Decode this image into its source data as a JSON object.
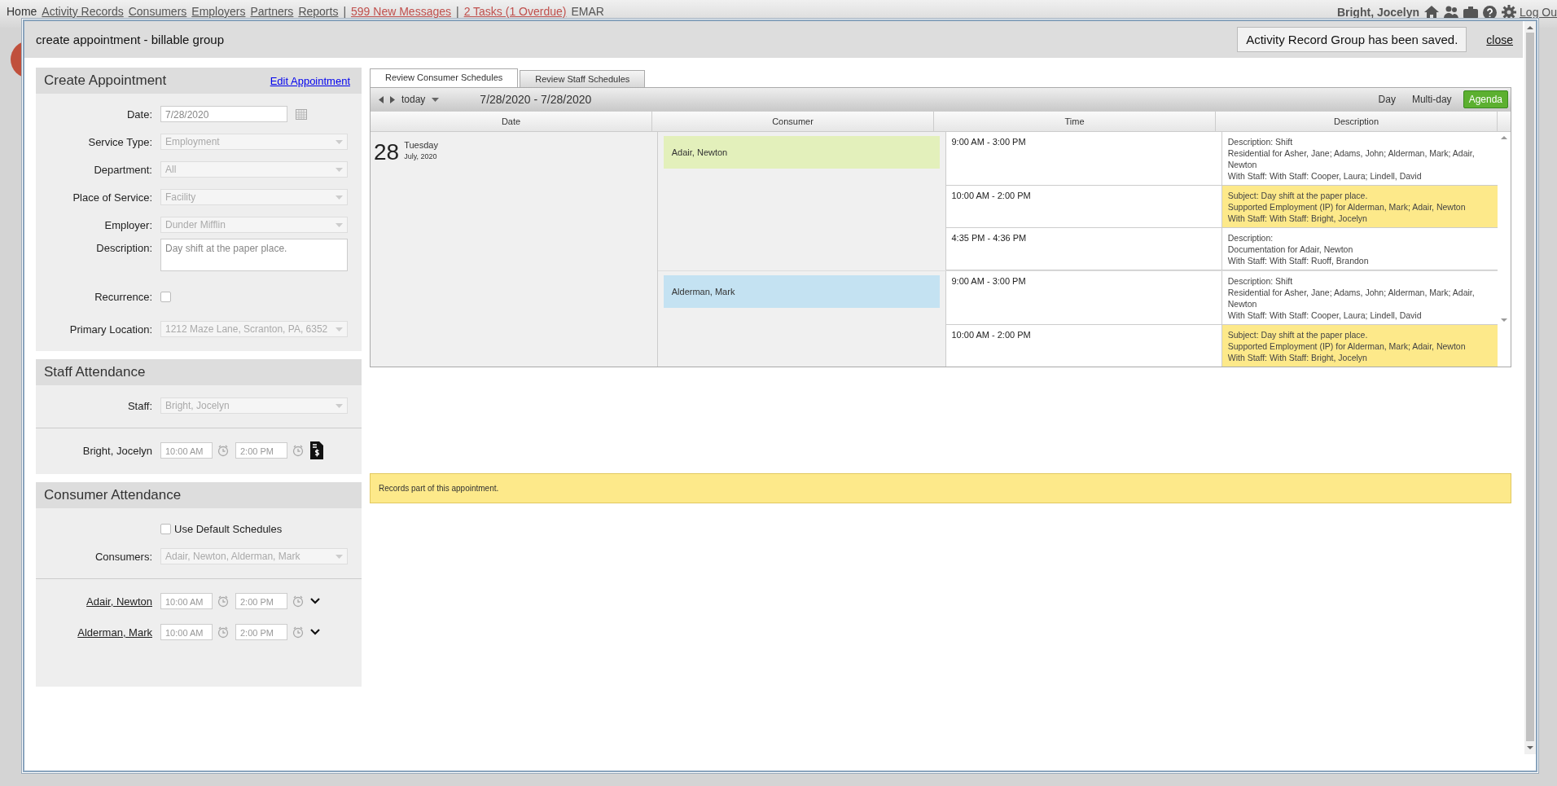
{
  "top_nav": {
    "links": [
      {
        "label": "Home",
        "kind": "home"
      },
      {
        "label": "Activity Records",
        "kind": "link"
      },
      {
        "label": "Consumers",
        "kind": "link"
      },
      {
        "label": "Employers",
        "kind": "link"
      },
      {
        "label": "Partners",
        "kind": "link"
      },
      {
        "label": "Reports",
        "kind": "link"
      },
      {
        "label": "|",
        "kind": "separator"
      },
      {
        "label": "599 New Messages",
        "kind": "alert"
      },
      {
        "label": "|",
        "kind": "separator"
      },
      {
        "label": "2 Tasks (1 Overdue)",
        "kind": "alert"
      },
      {
        "label": "EMAR",
        "kind": "plain"
      }
    ],
    "user": "Bright, Jocelyn",
    "logout": "Log Ou"
  },
  "dialog": {
    "title": "create appointment - billable group",
    "notice": "Activity Record Group has been saved.",
    "close": "close"
  },
  "create_appointment": {
    "title": "Create Appointment",
    "edit_link": "Edit Appointment",
    "fields": [
      {
        "label": "Date:",
        "kind": "date",
        "value": "7/28/2020"
      },
      {
        "label": "Service Type:",
        "kind": "select",
        "value": "Employment"
      },
      {
        "label": "Department:",
        "kind": "select",
        "value": "All"
      },
      {
        "label": "Place of Service:",
        "kind": "select",
        "value": "Facility"
      },
      {
        "label": "Employer:",
        "kind": "select",
        "value": "Dunder Mifflin"
      },
      {
        "label": "Description:",
        "kind": "textarea",
        "value": "Day shift at the paper place."
      },
      {
        "label": "Recurrence:",
        "kind": "checkbox",
        "checked": false
      },
      {
        "label": "Primary Location:",
        "kind": "select",
        "value": "1212 Maze Lane, Scranton, PA, 6352"
      }
    ]
  },
  "staff_attendance": {
    "title": "Staff Attendance",
    "staff_label": "Staff:",
    "staff_value": "Bright, Jocelyn",
    "rows": [
      {
        "name": "Bright, Jocelyn",
        "start": "10:00 AM",
        "end": "2:00 PM"
      }
    ]
  },
  "consumer_attendance": {
    "title": "Consumer Attendance",
    "default_schedules": {
      "label": "Use Default Schedules",
      "checked": false
    },
    "consumers_label": "Consumers:",
    "consumers_value": "Adair, Newton, Alderman, Mark",
    "rows": [
      {
        "name": "Adair, Newton",
        "start": "10:00 AM",
        "end": "2:00 PM"
      },
      {
        "name": "Alderman, Mark",
        "start": "10:00 AM",
        "end": "2:00 PM"
      }
    ]
  },
  "tabs": [
    {
      "label": "Review Consumer Schedules",
      "selected": true
    },
    {
      "label": "Review Staff Schedules",
      "selected": false
    }
  ],
  "toolbar": {
    "today": "today",
    "range": "7/28/2020 - 7/28/2020",
    "views": [
      {
        "label": "Day",
        "selected": false
      },
      {
        "label": "Multi-day",
        "selected": false
      },
      {
        "label": "Agenda",
        "selected": true
      }
    ]
  },
  "agenda": {
    "columns": [
      "Date",
      "Consumer",
      "Time",
      "Description"
    ],
    "day": {
      "number": "28",
      "weekday": "Tuesday",
      "month_year": "July, 2020"
    },
    "groups": [
      {
        "consumer": "Adair, Newton",
        "color": "#e3f0bb",
        "events": [
          {
            "time": "9:00 AM - 3:00 PM",
            "highlighted": false,
            "lines": [
              "Description: Shift",
              "Residential for Asher, Jane; Adams, John; Alderman, Mark; Adair, Newton",
              "With Staff: With Staff: Cooper, Laura; Lindell, David"
            ]
          },
          {
            "time": "10:00 AM - 2:00 PM",
            "highlighted": true,
            "lines": [
              "Subject: Day shift at the paper place.",
              "Supported Employment (IP) for Alderman, Mark; Adair, Newton",
              "With Staff: With Staff: Bright, Jocelyn"
            ]
          },
          {
            "time": "4:35 PM - 4:36 PM",
            "highlighted": false,
            "lines": [
              "Description:",
              "Documentation for Adair, Newton",
              "With Staff: With Staff: Ruoff, Brandon"
            ]
          }
        ]
      },
      {
        "consumer": "Alderman, Mark",
        "color": "#c4e2f2",
        "events": [
          {
            "time": "9:00 AM - 3:00 PM",
            "highlighted": false,
            "lines": [
              "Description: Shift",
              "Residential for Asher, Jane; Adams, John; Alderman, Mark; Adair, Newton",
              "With Staff: With Staff: Cooper, Laura; Lindell, David"
            ]
          },
          {
            "time": "10:00 AM - 2:00 PM",
            "highlighted": true,
            "lines": [
              "Subject: Day shift at the paper place.",
              "Supported Employment (IP) for Alderman, Mark; Adair, Newton",
              "With Staff: With Staff: Bright, Jocelyn"
            ]
          }
        ]
      }
    ]
  },
  "note": "Records part of this appointment."
}
